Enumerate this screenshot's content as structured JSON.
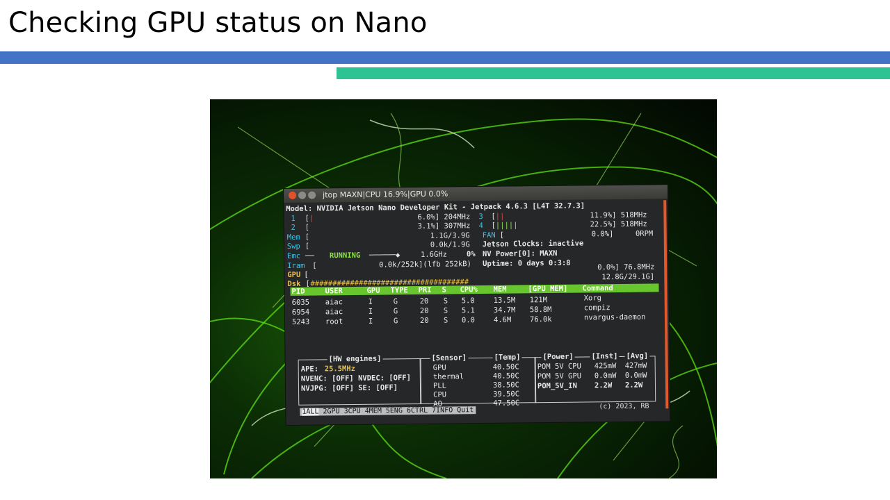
{
  "slide": {
    "title": "Checking GPU status on Nano"
  },
  "window": {
    "title": "jtop MAXN|CPU 16.9%|GPU 0.0%"
  },
  "model_line": "Model: NVIDIA Jetson Nano Developer Kit - Jetpack 4.6.3 [L4T 32.7.3]",
  "cpus": [
    {
      "id": "1",
      "value": "6.0%] 204MHz"
    },
    {
      "id": "2",
      "value": "3.1%] 307MHz"
    },
    {
      "id": "3",
      "value": "11.9%] 518MHz"
    },
    {
      "id": "4",
      "value": "22.5%] 518MHz"
    }
  ],
  "mem": {
    "label": "Mem",
    "value": "1.1G/3.9G"
  },
  "swp": {
    "label": "Swp",
    "value": "0.0k/1.9G"
  },
  "emc": {
    "label": "Emc",
    "state": "RUNNING",
    "value": "1.6GHz",
    "pct": "0%"
  },
  "iram": {
    "label": "Iram",
    "value": "0.0k/252k](lfb 252kB)"
  },
  "gpu": {
    "label": "GPU",
    "value": "0.0%] 76.8MHz"
  },
  "dsk": {
    "label": "Dsk",
    "bar": "####################################",
    "value": "12.8G/29.1G]"
  },
  "fan": {
    "label": "FAN",
    "value": "0.0%]     0RPM"
  },
  "info": {
    "clocks": "Jetson Clocks: inactive",
    "power": "NV Power[0]: MAXN",
    "uptime": "Uptime: 0 days 0:3:8"
  },
  "proc_table": {
    "headers": [
      "PID",
      "USER",
      "GPU",
      "TYPE",
      "PRI",
      "S",
      "CPU%",
      "MEM",
      "[GPU MEM]",
      "Command"
    ],
    "rows": [
      [
        "6035",
        "aiac",
        "I",
        "G",
        "20",
        "S",
        "5.0",
        "13.5M",
        "121M",
        "Xorg"
      ],
      [
        "6954",
        "aiac",
        "I",
        "G",
        "20",
        "S",
        "5.1",
        "34.7M",
        "58.8M",
        "compiz"
      ],
      [
        "5243",
        "root",
        "I",
        "G",
        "20",
        "S",
        "0.0",
        "4.6M",
        "76.0k",
        "nvargus-daemon"
      ]
    ]
  },
  "hw_engines": {
    "title": "[HW engines]",
    "ape_label": "APE:",
    "ape_value": "25.5MHz",
    "nvenc": "NVENC: [OFF] NVDEC: [OFF]",
    "nvjpg": "NVJPG: [OFF] SE: [OFF]"
  },
  "sensors": {
    "title": "[Sensor]",
    "temp_title": "[Temp]",
    "items": [
      {
        "name": "GPU",
        "temp": "40.50C"
      },
      {
        "name": "thermal",
        "temp": "40.50C"
      },
      {
        "name": "PLL",
        "temp": "38.50C"
      },
      {
        "name": "CPU",
        "temp": "39.50C"
      },
      {
        "name": "AO",
        "temp": "47.50C"
      }
    ]
  },
  "power": {
    "title": "[Power]",
    "inst_title": "[Inst]",
    "avg_title": "[Avg]",
    "items": [
      {
        "name": "POM 5V CPU",
        "inst": "425mW",
        "avg": "427mW"
      },
      {
        "name": "POM 5V GPU",
        "inst": "0.0mW",
        "avg": "0.0mW"
      },
      {
        "name": "POM_5V_IN",
        "inst": "2.2W",
        "avg": "2.2W"
      }
    ]
  },
  "tabs": [
    "1ALL",
    "2GPU",
    "3CPU",
    "4MEM",
    "5ENG",
    "6CTRL",
    "7INFO",
    "Quit"
  ],
  "copyright": "(c) 2023, RB"
}
